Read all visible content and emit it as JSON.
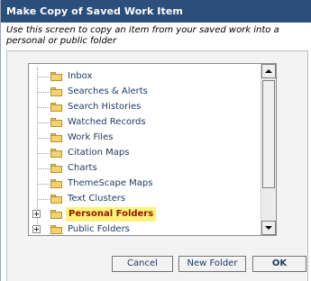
{
  "dialog": {
    "title": "Make Copy of Saved Work Item",
    "instructions": "Use this screen to copy an item from your saved work into a personal or public folder"
  },
  "tree": {
    "items": [
      {
        "label": "Inbox",
        "expandable": false,
        "selected": false
      },
      {
        "label": "Searches & Alerts",
        "expandable": false,
        "selected": false
      },
      {
        "label": "Search Histories",
        "expandable": false,
        "selected": false
      },
      {
        "label": "Watched Records",
        "expandable": false,
        "selected": false
      },
      {
        "label": "Work Files",
        "expandable": false,
        "selected": false
      },
      {
        "label": "Citation Maps",
        "expandable": false,
        "selected": false
      },
      {
        "label": "Charts",
        "expandable": false,
        "selected": false
      },
      {
        "label": "ThemeScape Maps",
        "expandable": false,
        "selected": false
      },
      {
        "label": "Text Clusters",
        "expandable": false,
        "selected": false
      },
      {
        "label": "Personal Folders",
        "expandable": true,
        "selected": true
      },
      {
        "label": "Public Folders",
        "expandable": true,
        "selected": false
      }
    ]
  },
  "buttons": {
    "cancel": "Cancel",
    "new_folder": "New Folder",
    "ok": "OK"
  },
  "colors": {
    "titlebar": "#2c4e7b",
    "selected_highlight": "#fff27a",
    "selected_text": "#8a1a00",
    "folder": "#f4d36e"
  }
}
